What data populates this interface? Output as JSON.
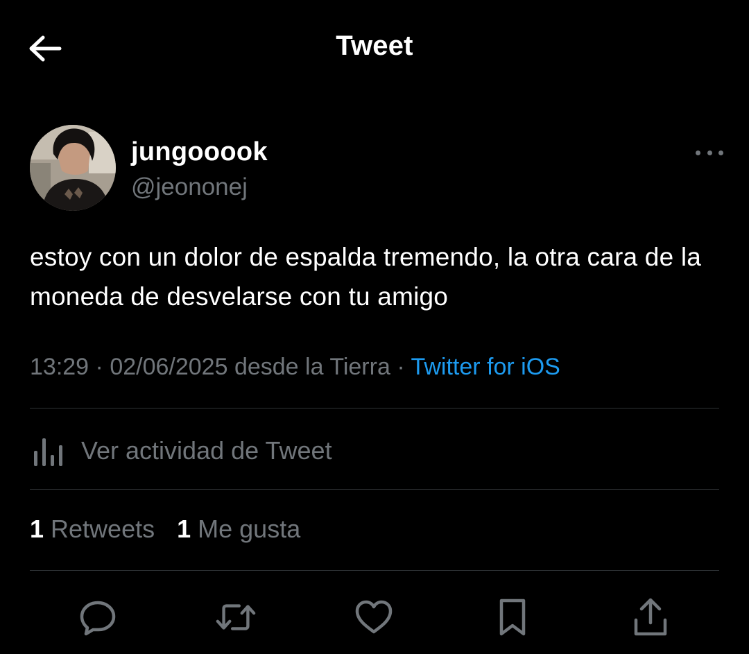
{
  "header": {
    "title": "Tweet",
    "back_icon": "arrow-left-icon"
  },
  "author": {
    "display_name": "jungooook",
    "handle": "@jeononej",
    "avatar": "avatar-photo",
    "more_icon": "more-horizontal-icon"
  },
  "tweet": {
    "text": "estoy con un dolor de espalda tremendo, la otra cara de la moneda de desvelarse con tu amigo",
    "time": "13:29",
    "date": "02/06/2025",
    "location": "desde la Tierra",
    "source": "Twitter for iOS",
    "separator": "·"
  },
  "activity": {
    "icon": "analytics-bars-icon",
    "label": "Ver actividad de Tweet"
  },
  "stats": {
    "retweets_count": "1",
    "retweets_label": "Retweets",
    "likes_count": "1",
    "likes_label": "Me gusta"
  },
  "actions": [
    "reply-icon",
    "retweet-icon",
    "like-icon",
    "bookmark-icon",
    "share-icon"
  ],
  "colors": {
    "background": "#000000",
    "text_primary": "#ffffff",
    "text_secondary": "#71767b",
    "link": "#1d9bf0",
    "divider": "#2f3336"
  }
}
